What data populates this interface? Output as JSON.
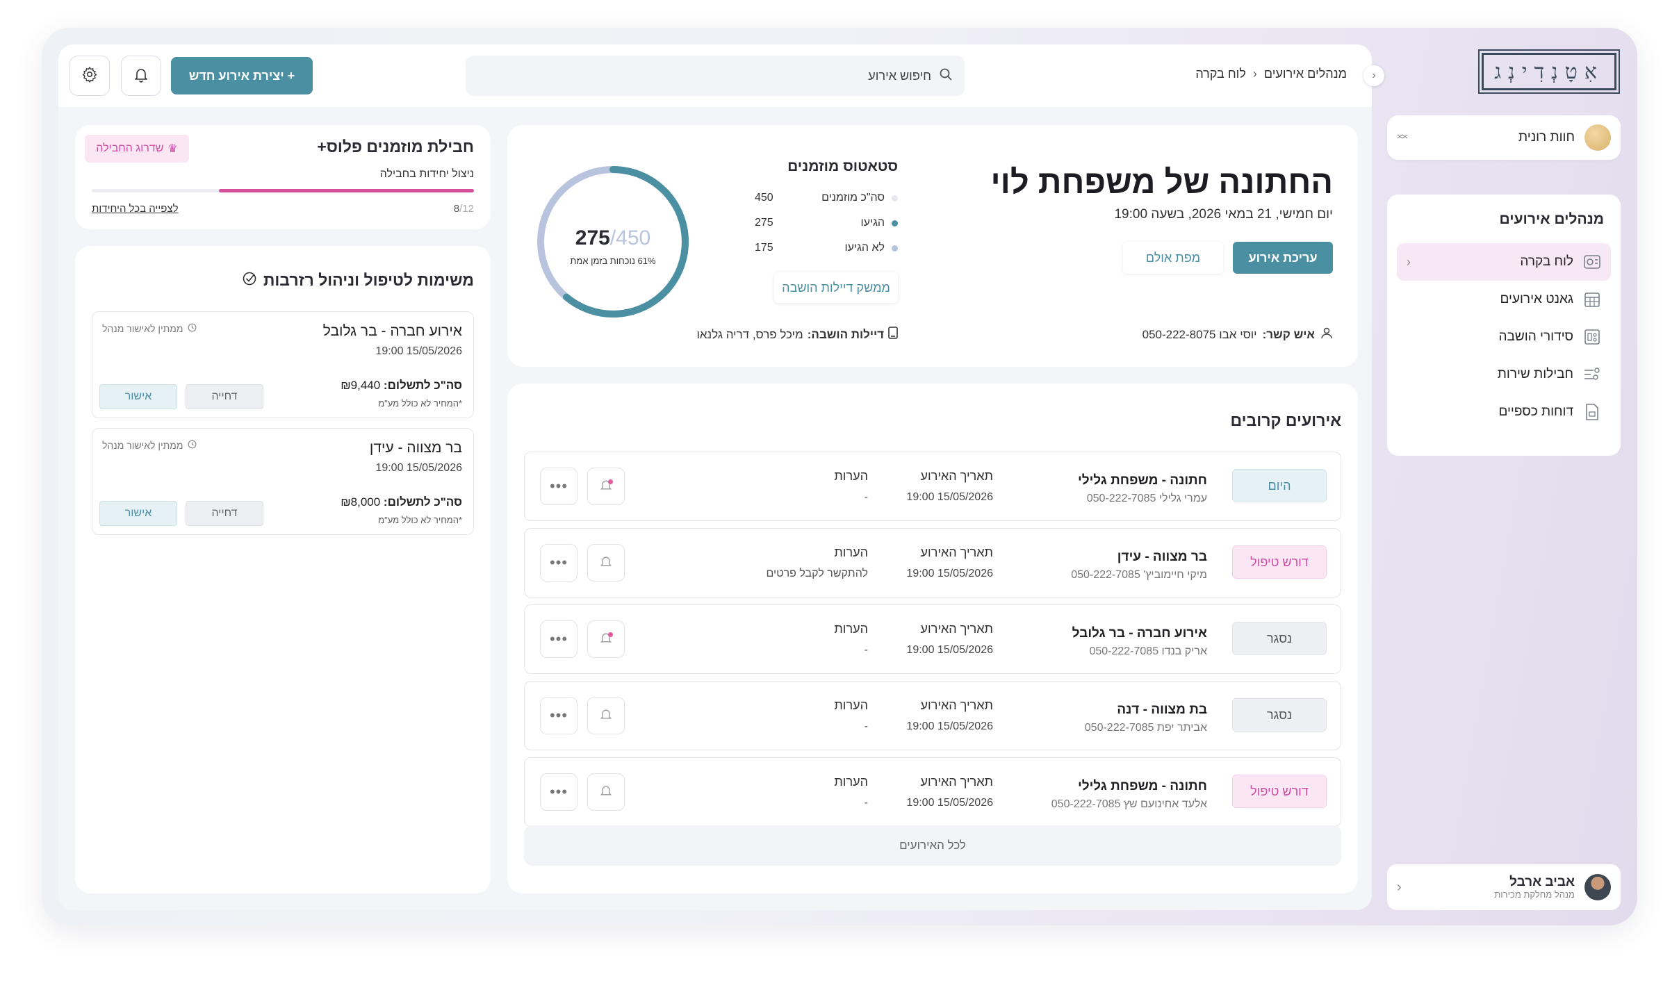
{
  "app": {
    "logo_text": "אִטָנְדִינְג"
  },
  "user_switch": {
    "name": "חוות רונית"
  },
  "nav": {
    "title": "מנהלים אירועים",
    "items": [
      {
        "label": "לוח בקרה",
        "icon": "dashboard-icon"
      },
      {
        "label": "גאנט אירועים",
        "icon": "calendar-grid-icon"
      },
      {
        "label": "סידורי הושבה",
        "icon": "seating-icon"
      },
      {
        "label": "חבילות שירות",
        "icon": "packages-icon"
      },
      {
        "label": "דוחות כספיים",
        "icon": "financial-report-icon"
      }
    ]
  },
  "profile": {
    "name": "אביב ארבל",
    "role": "מנהל מחלקת מכירות"
  },
  "topbar": {
    "breadcrumb": [
      "מנהלים אירועים",
      "לוח בקרה"
    ],
    "search_placeholder": "חיפוש אירוע",
    "create_label": "+ יצירת אירוע חדש"
  },
  "event": {
    "title": "החתונה של משפחת לוי",
    "date_line": "יום חמישי, 21 במאי 2026, בשעה 19:00",
    "edit_label": "עריכת אירוע",
    "map_label": "מפת אולם",
    "contact_label": "איש קשר:",
    "contact_value": "יוסי אבו 050-222-8075",
    "status_title": "סטאטוס מוזמנים",
    "status": [
      {
        "label": "סה\"כ מוזמנים",
        "value": "450",
        "color": "#e6e8ec"
      },
      {
        "label": "הגיעו",
        "value": "275",
        "color": "#4b8fa3"
      },
      {
        "label": "לא הגיעו",
        "value": "175",
        "color": "#b8c3de"
      }
    ],
    "seating_btn": "ממשק דיילות הושבה",
    "seaters_label": "דיילות הושבה:",
    "seaters_value": "מיכל פרס, דריה גלנאו",
    "donut": {
      "arrived": 275,
      "total": 450,
      "center_sep": "/",
      "caption": "61% נוכחות בזמן אמת",
      "arrived_color": "#4b8fa3",
      "rest_color": "#b8c3de"
    }
  },
  "upcoming": {
    "title": "אירועים קרובים",
    "date_label": "תאריך האירוע",
    "notes_label": "הערות",
    "rows": [
      {
        "status": "היום",
        "kind": "today",
        "name": "חתונה - משפחת גלילי",
        "sub": "עמרי גלילי 050-222-7085",
        "date": "15/05/2026 19:00",
        "note": "-",
        "bell_dot": true
      },
      {
        "status": "דורש טיפול",
        "kind": "need",
        "name": "בר מצווה - עידן",
        "sub": "מיקי חיימוביץ' 050-222-7085",
        "date": "15/05/2026 19:00",
        "note": "להתקשר לקבל פרטים",
        "bell_dot": false
      },
      {
        "status": "נסגר",
        "kind": "closed",
        "name": "אירוע חברה - בר גלובל",
        "sub": "אריק בנדו 050-222-7085",
        "date": "15/05/2026 19:00",
        "note": "-",
        "bell_dot": true
      },
      {
        "status": "נסגר",
        "kind": "closed",
        "name": "בת מצווה - דנה",
        "sub": "אביתר יפת 050-222-7085",
        "date": "15/05/2026 19:00",
        "note": "-",
        "bell_dot": false
      },
      {
        "status": "דורש טיפול",
        "kind": "need",
        "name": "חתונה - משפחת גלילי",
        "sub": "אלעד אחינועם שץ 050-222-7085",
        "date": "15/05/2026 19:00",
        "note": "-",
        "bell_dot": false
      }
    ],
    "all_label": "לכל האירועים"
  },
  "package": {
    "title": "חבילת מוזמנים פלוס+",
    "badge": "שדרוג החבילה",
    "usage_label": "ניצול יחידות בחבילה",
    "used": "8",
    "total_text": "/12",
    "used_fraction": 0.667,
    "link": "לצפייה בכל היחידות"
  },
  "tasks": {
    "title": "משימות לטיפול וניהול רזרבות",
    "total_label": "סה\"כ לתשלום:",
    "status_label": "ממתין לאישור מנהל",
    "approve_label": "אישור",
    "reject_label": "דחייה",
    "note": "*המחיר לא כולל מע\"מ",
    "items": [
      {
        "name": "אירוע חברה - בר גלובל",
        "date": "15/05/2026 19:00",
        "amount": "₪9,440"
      },
      {
        "name": "בר מצווה - עידן",
        "date": "15/05/2026 19:00",
        "amount": "₪8,000"
      }
    ]
  }
}
